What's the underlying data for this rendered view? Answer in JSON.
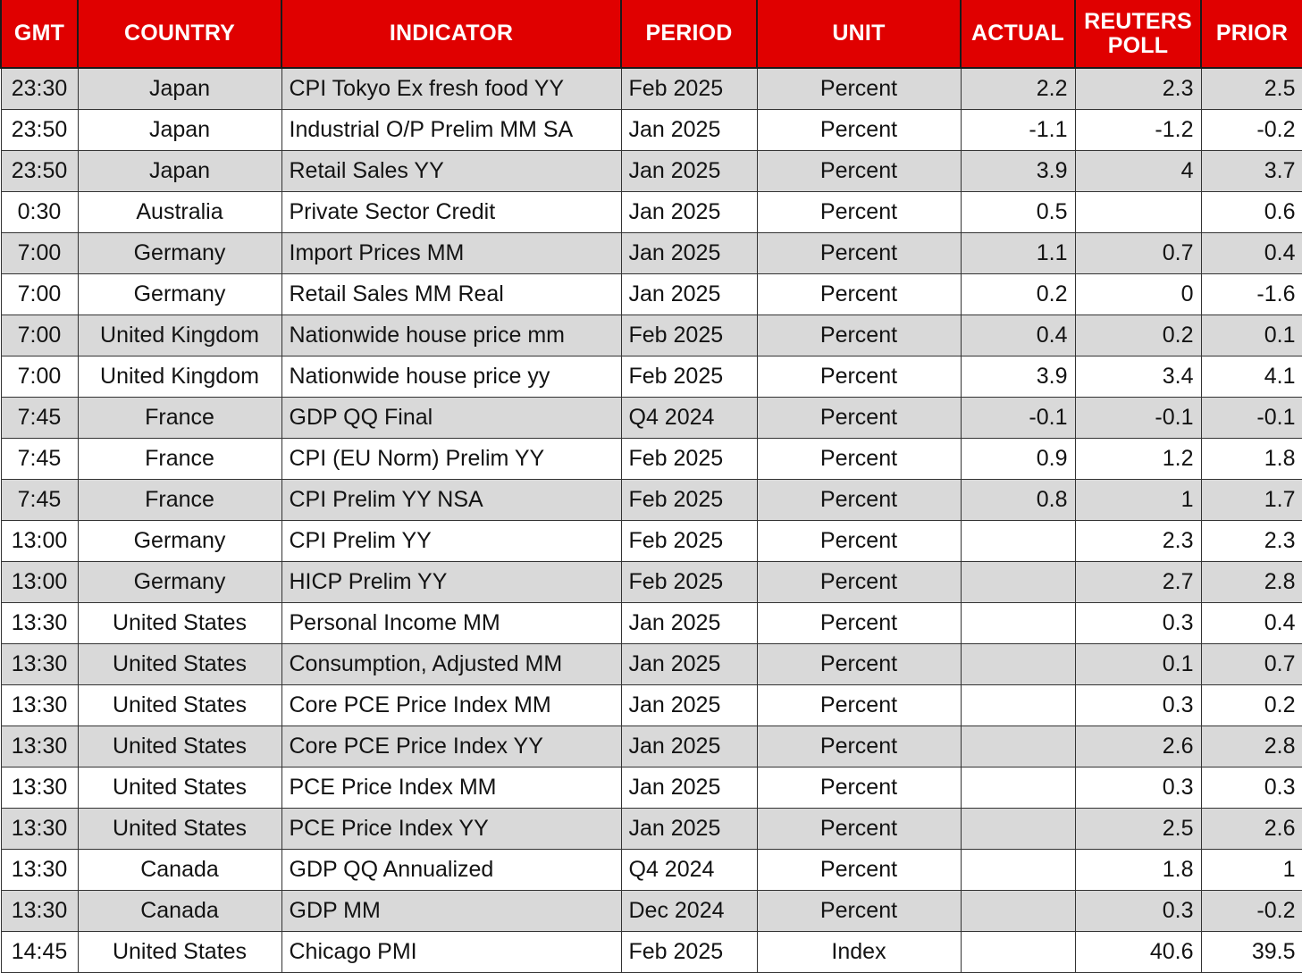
{
  "table": {
    "headers": [
      {
        "label": "GMT",
        "lines": [
          "GMT"
        ]
      },
      {
        "label": "COUNTRY",
        "lines": [
          "COUNTRY"
        ]
      },
      {
        "label": "INDICATOR",
        "lines": [
          "INDICATOR"
        ]
      },
      {
        "label": "PERIOD",
        "lines": [
          "PERIOD"
        ]
      },
      {
        "label": "UNIT",
        "lines": [
          "UNIT"
        ]
      },
      {
        "label": "ACTUAL",
        "lines": [
          "ACTUAL"
        ]
      },
      {
        "label": "REUTERS POLL",
        "lines": [
          "REUTERS",
          "POLL"
        ]
      },
      {
        "label": "PRIOR",
        "lines": [
          "PRIOR"
        ]
      }
    ],
    "header_line1": "REUTERS",
    "header_line2": "POLL",
    "colors": {
      "header_background": "#E00000",
      "header_text": "#FFFFFF",
      "row_shaded": "#D9D9D9",
      "row_plain": "#FFFFFF",
      "border": "#333333",
      "body_text": "#131313"
    },
    "rows": [
      {
        "gmt": "23:30",
        "country": "Japan",
        "indicator": "CPI Tokyo Ex fresh food YY",
        "period": "Feb 2025",
        "unit": "Percent",
        "actual": "2.2",
        "poll": "2.3",
        "prior": "2.5"
      },
      {
        "gmt": "23:50",
        "country": "Japan",
        "indicator": "Industrial O/P Prelim MM SA",
        "period": "Jan 2025",
        "unit": "Percent",
        "actual": "-1.1",
        "poll": "-1.2",
        "prior": "-0.2"
      },
      {
        "gmt": "23:50",
        "country": "Japan",
        "indicator": "Retail Sales YY",
        "period": "Jan 2025",
        "unit": "Percent",
        "actual": "3.9",
        "poll": "4",
        "prior": "3.7"
      },
      {
        "gmt": "0:30",
        "country": "Australia",
        "indicator": "Private Sector Credit",
        "period": "Jan 2025",
        "unit": "Percent",
        "actual": "0.5",
        "poll": "",
        "prior": "0.6"
      },
      {
        "gmt": "7:00",
        "country": "Germany",
        "indicator": "Import Prices MM",
        "period": "Jan 2025",
        "unit": "Percent",
        "actual": "1.1",
        "poll": "0.7",
        "prior": "0.4"
      },
      {
        "gmt": "7:00",
        "country": "Germany",
        "indicator": "Retail Sales MM Real",
        "period": "Jan 2025",
        "unit": "Percent",
        "actual": "0.2",
        "poll": "0",
        "prior": "-1.6"
      },
      {
        "gmt": "7:00",
        "country": "United Kingdom",
        "indicator": "Nationwide house price mm",
        "period": "Feb 2025",
        "unit": "Percent",
        "actual": "0.4",
        "poll": "0.2",
        "prior": "0.1"
      },
      {
        "gmt": "7:00",
        "country": "United Kingdom",
        "indicator": "Nationwide house price yy",
        "period": "Feb 2025",
        "unit": "Percent",
        "actual": "3.9",
        "poll": "3.4",
        "prior": "4.1"
      },
      {
        "gmt": "7:45",
        "country": "France",
        "indicator": "GDP QQ Final",
        "period": "Q4 2024",
        "unit": "Percent",
        "actual": "-0.1",
        "poll": "-0.1",
        "prior": "-0.1"
      },
      {
        "gmt": "7:45",
        "country": "France",
        "indicator": "CPI (EU Norm) Prelim YY",
        "period": "Feb 2025",
        "unit": "Percent",
        "actual": "0.9",
        "poll": "1.2",
        "prior": "1.8"
      },
      {
        "gmt": "7:45",
        "country": "France",
        "indicator": "CPI Prelim YY NSA",
        "period": "Feb 2025",
        "unit": "Percent",
        "actual": "0.8",
        "poll": "1",
        "prior": "1.7"
      },
      {
        "gmt": "13:00",
        "country": "Germany",
        "indicator": "CPI Prelim YY",
        "period": "Feb 2025",
        "unit": "Percent",
        "actual": "",
        "poll": "2.3",
        "prior": "2.3"
      },
      {
        "gmt": "13:00",
        "country": "Germany",
        "indicator": "HICP Prelim YY",
        "period": "Feb 2025",
        "unit": "Percent",
        "actual": "",
        "poll": "2.7",
        "prior": "2.8"
      },
      {
        "gmt": "13:30",
        "country": "United States",
        "indicator": "Personal Income MM",
        "period": "Jan 2025",
        "unit": "Percent",
        "actual": "",
        "poll": "0.3",
        "prior": "0.4"
      },
      {
        "gmt": "13:30",
        "country": "United States",
        "indicator": "Consumption, Adjusted MM",
        "period": "Jan 2025",
        "unit": "Percent",
        "actual": "",
        "poll": "0.1",
        "prior": "0.7"
      },
      {
        "gmt": "13:30",
        "country": "United States",
        "indicator": "Core PCE Price Index MM",
        "period": "Jan 2025",
        "unit": "Percent",
        "actual": "",
        "poll": "0.3",
        "prior": "0.2"
      },
      {
        "gmt": "13:30",
        "country": "United States",
        "indicator": "Core PCE Price Index YY",
        "period": "Jan 2025",
        "unit": "Percent",
        "actual": "",
        "poll": "2.6",
        "prior": "2.8"
      },
      {
        "gmt": "13:30",
        "country": "United States",
        "indicator": "PCE Price Index MM",
        "period": "Jan 2025",
        "unit": "Percent",
        "actual": "",
        "poll": "0.3",
        "prior": "0.3"
      },
      {
        "gmt": "13:30",
        "country": "United States",
        "indicator": "PCE Price Index YY",
        "period": "Jan 2025",
        "unit": "Percent",
        "actual": "",
        "poll": "2.5",
        "prior": "2.6"
      },
      {
        "gmt": "13:30",
        "country": "Canada",
        "indicator": "GDP QQ Annualized",
        "period": "Q4 2024",
        "unit": "Percent",
        "actual": "",
        "poll": "1.8",
        "prior": "1"
      },
      {
        "gmt": "13:30",
        "country": "Canada",
        "indicator": "GDP MM",
        "period": "Dec 2024",
        "unit": "Percent",
        "actual": "",
        "poll": "0.3",
        "prior": "-0.2"
      },
      {
        "gmt": "14:45",
        "country": "United States",
        "indicator": "Chicago PMI",
        "period": "Feb 2025",
        "unit": "Index",
        "actual": "",
        "poll": "40.6",
        "prior": "39.5"
      }
    ]
  }
}
